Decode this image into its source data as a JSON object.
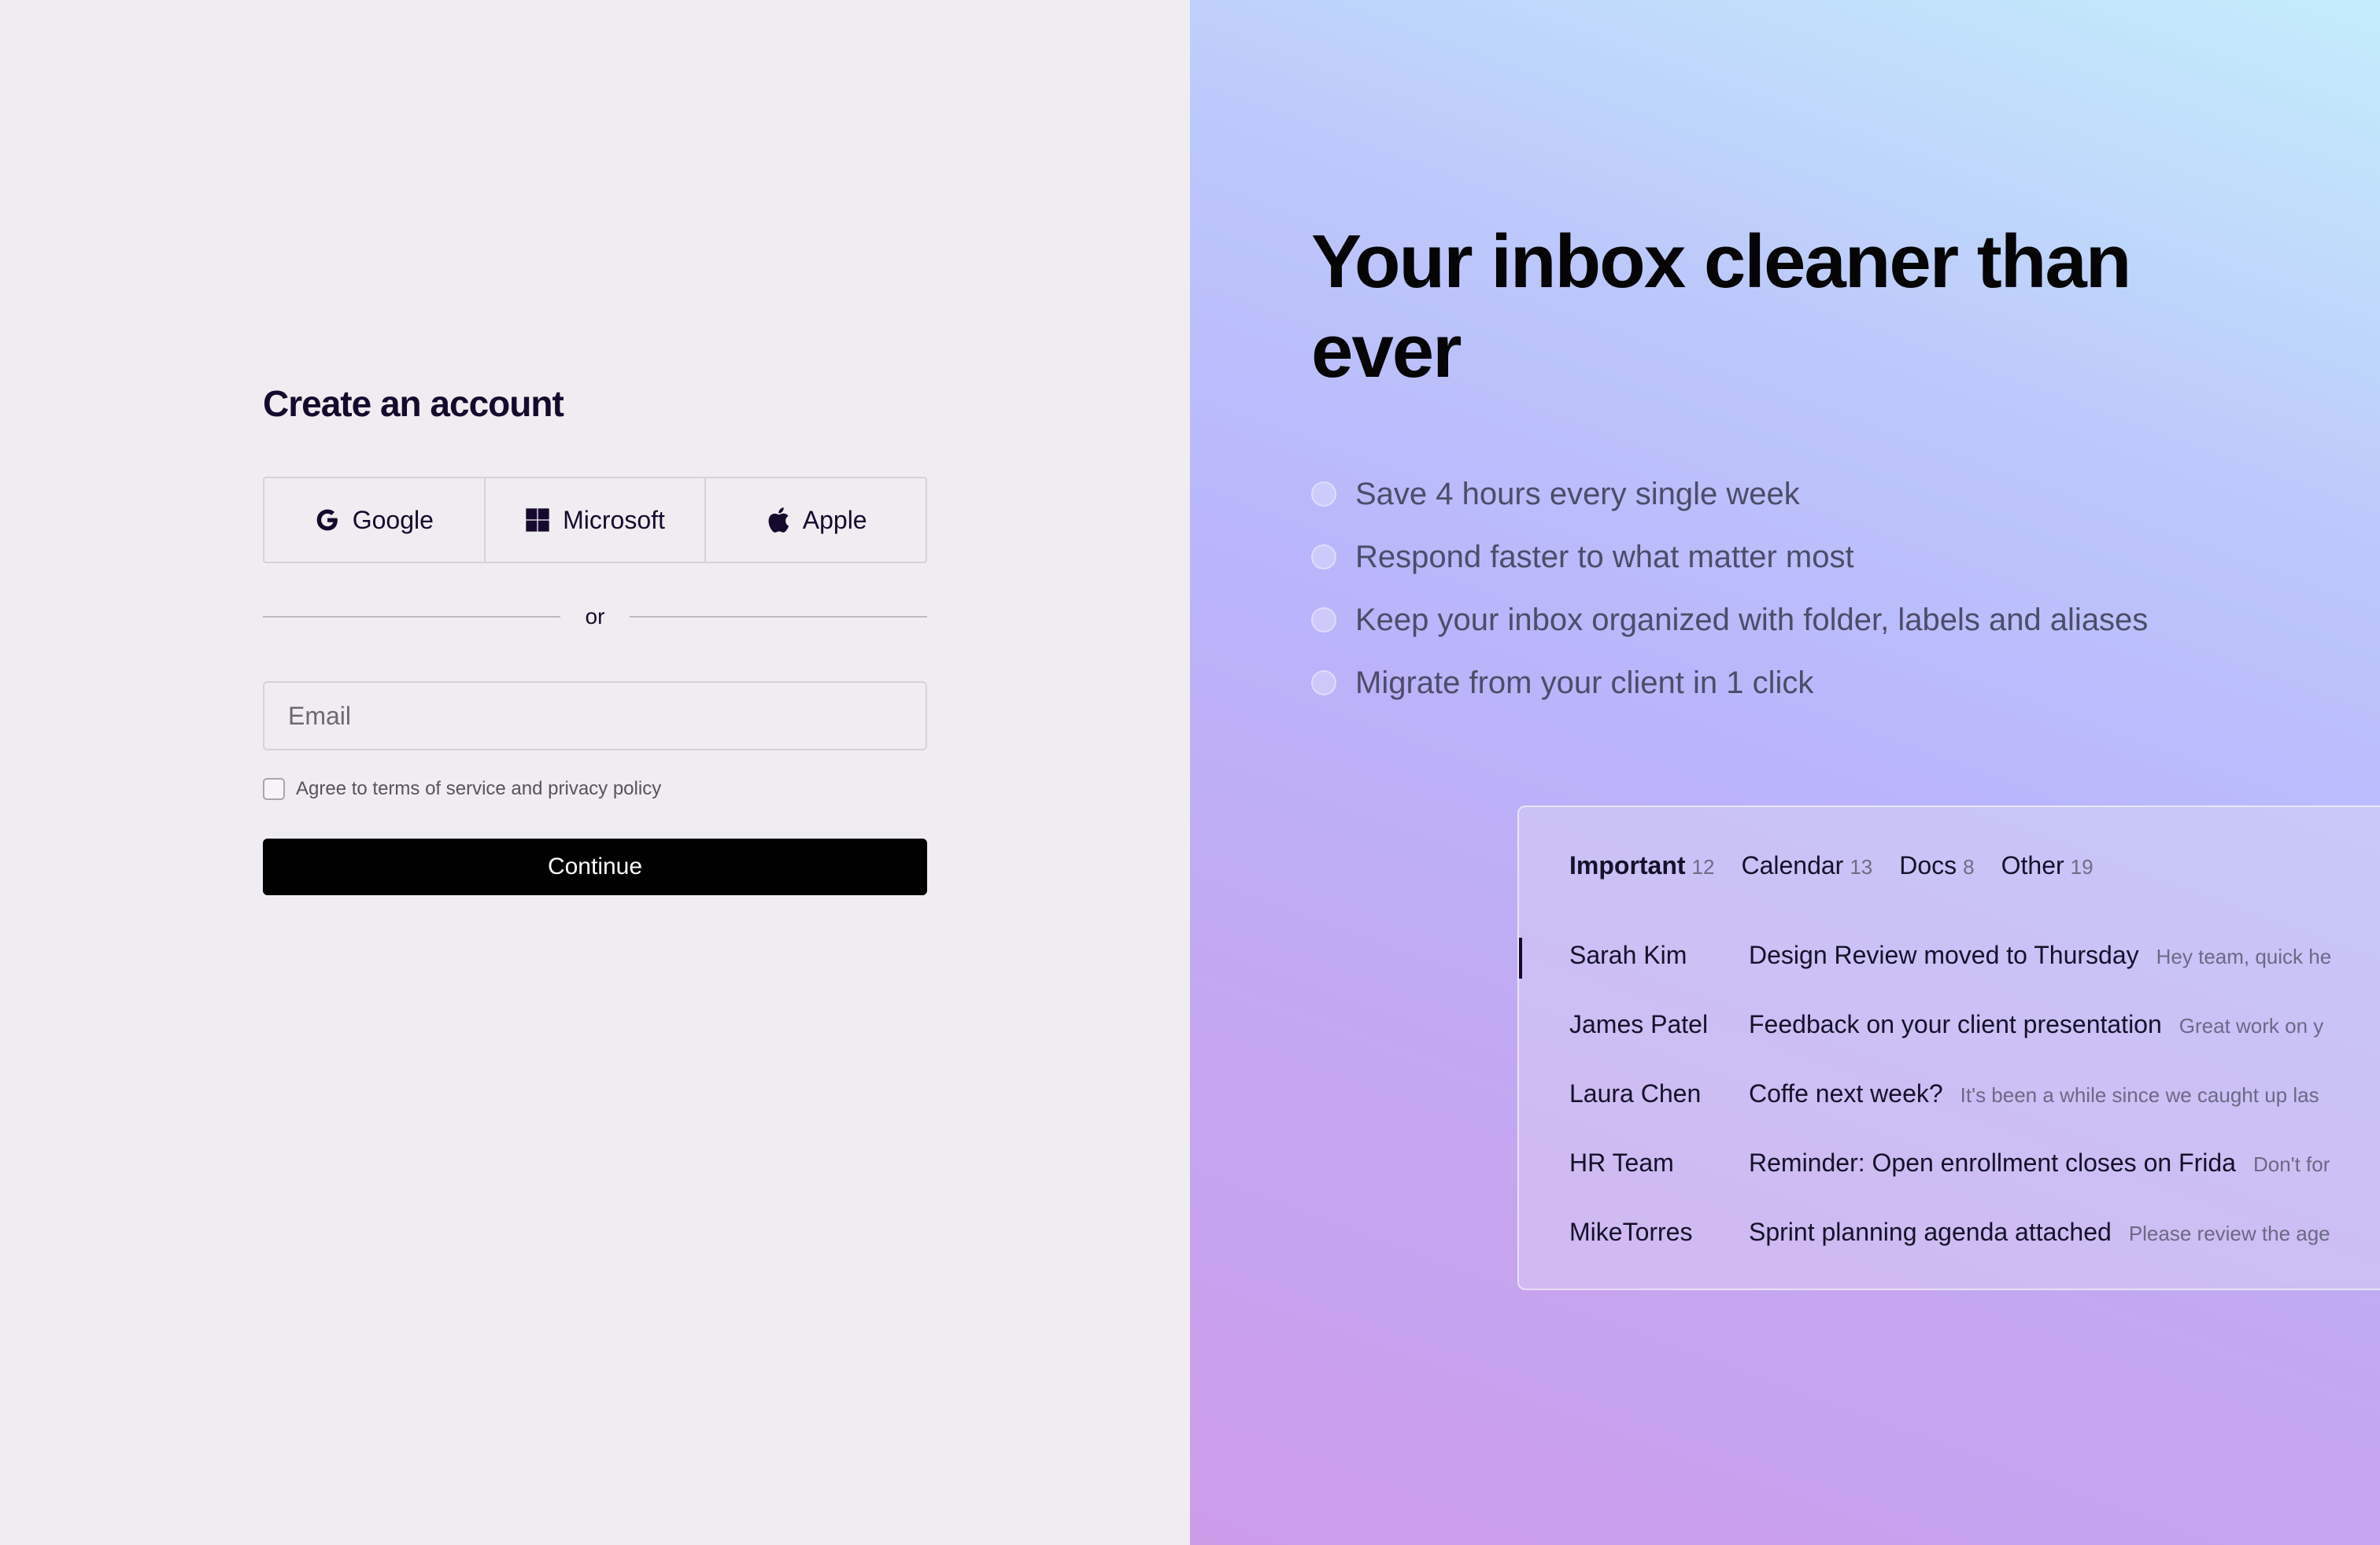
{
  "signup": {
    "title": "Create an account",
    "sso": [
      {
        "label": "Google",
        "icon": "google-icon"
      },
      {
        "label": "Microsoft",
        "icon": "microsoft-icon"
      },
      {
        "label": "Apple",
        "icon": "apple-icon"
      }
    ],
    "divider_text": "or",
    "email_placeholder": "Email",
    "email_value": "",
    "agree_label": "Agree to terms of service and privacy policy",
    "agree_checked": false,
    "continue_label": "Continue"
  },
  "promo": {
    "headline": "Your inbox cleaner than ever",
    "features": [
      "Save 4 hours every single week",
      "Respond faster to what matter most",
      "Keep your inbox organized with folder, labels and aliases",
      "Migrate from your client in 1 click"
    ]
  },
  "inbox": {
    "tabs": [
      {
        "label": "Important",
        "count": "12",
        "active": true
      },
      {
        "label": "Calendar",
        "count": "13",
        "active": false
      },
      {
        "label": "Docs",
        "count": "8",
        "active": false
      },
      {
        "label": "Other",
        "count": "19",
        "active": false
      }
    ],
    "messages": [
      {
        "sender": "Sarah Kim",
        "subject": "Design Review moved to Thursday",
        "preview": "Hey team, quick he",
        "selected": true
      },
      {
        "sender": "James Patel",
        "subject": "Feedback on your client presentation",
        "preview": "Great work on y",
        "selected": false
      },
      {
        "sender": "Laura Chen",
        "subject": "Coffe next week?",
        "preview": "It's been a while since we caught up las",
        "selected": false
      },
      {
        "sender": "HR Team",
        "subject": "Reminder: Open enrollment closes on Frida",
        "preview": "Don't for",
        "selected": false
      },
      {
        "sender": "MikeTorres",
        "subject": "Sprint planning agenda attached",
        "preview": "Please review the age",
        "selected": false
      }
    ]
  },
  "colors": {
    "left_background": "#efedf1",
    "primary_text": "#150a2e",
    "button_background": "#000000",
    "button_text": "#ffffff"
  }
}
